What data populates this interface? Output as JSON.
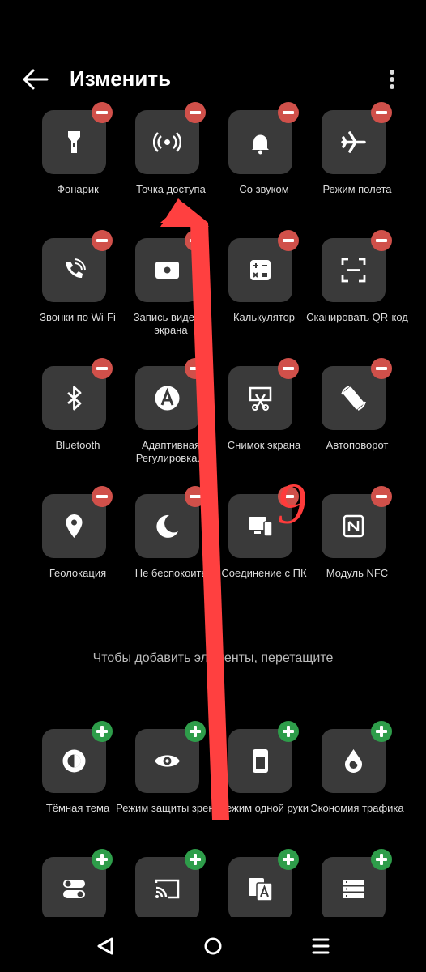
{
  "header": {
    "title": "Изменить"
  },
  "active_tiles": [
    {
      "label": "Фонарик",
      "icon": "flashlight-icon"
    },
    {
      "label": "Точка доступа",
      "icon": "hotspot-icon"
    },
    {
      "label": "Со звуком",
      "icon": "bell-icon"
    },
    {
      "label": "Режим полета",
      "icon": "airplane-icon"
    },
    {
      "label": "Звонки по Wi-Fi",
      "icon": "wifi-call-icon"
    },
    {
      "label": "Запись видео с экрана",
      "icon": "screen-record-icon"
    },
    {
      "label": "Калькулятор",
      "icon": "calculator-icon"
    },
    {
      "label": "Сканировать QR-код",
      "icon": "qr-scan-icon"
    },
    {
      "label": "Bluetooth",
      "icon": "bluetooth-icon"
    },
    {
      "label": "Адаптивная Регулировка...",
      "icon": "adaptive-brightness-icon"
    },
    {
      "label": "Снимок экрана",
      "icon": "screenshot-icon"
    },
    {
      "label": "Автоповорот",
      "icon": "auto-rotate-icon"
    },
    {
      "label": "Геолокация",
      "icon": "location-icon"
    },
    {
      "label": "Не беспокоить",
      "icon": "moon-icon"
    },
    {
      "label": "Соединение с ПК",
      "icon": "pc-connect-icon"
    },
    {
      "label": "Модуль NFC",
      "icon": "nfc-icon"
    }
  ],
  "hint": "Чтобы добавить элементы, перетащите",
  "available_tiles": [
    {
      "label": "Тёмная тема",
      "icon": "dark-theme-icon"
    },
    {
      "label": "Режим защиты зрения",
      "icon": "eye-icon"
    },
    {
      "label": "Режим одной руки",
      "icon": "one-hand-icon"
    },
    {
      "label": "Экономия трафика",
      "icon": "data-saver-icon"
    },
    {
      "label": "",
      "icon": "toggles-icon"
    },
    {
      "label": "",
      "icon": "cast-icon"
    },
    {
      "label": "",
      "icon": "translate-icon"
    },
    {
      "label": "",
      "icon": "list-icon"
    }
  ],
  "annotation": {
    "text": "9",
    "color": "#ff3b3b"
  }
}
